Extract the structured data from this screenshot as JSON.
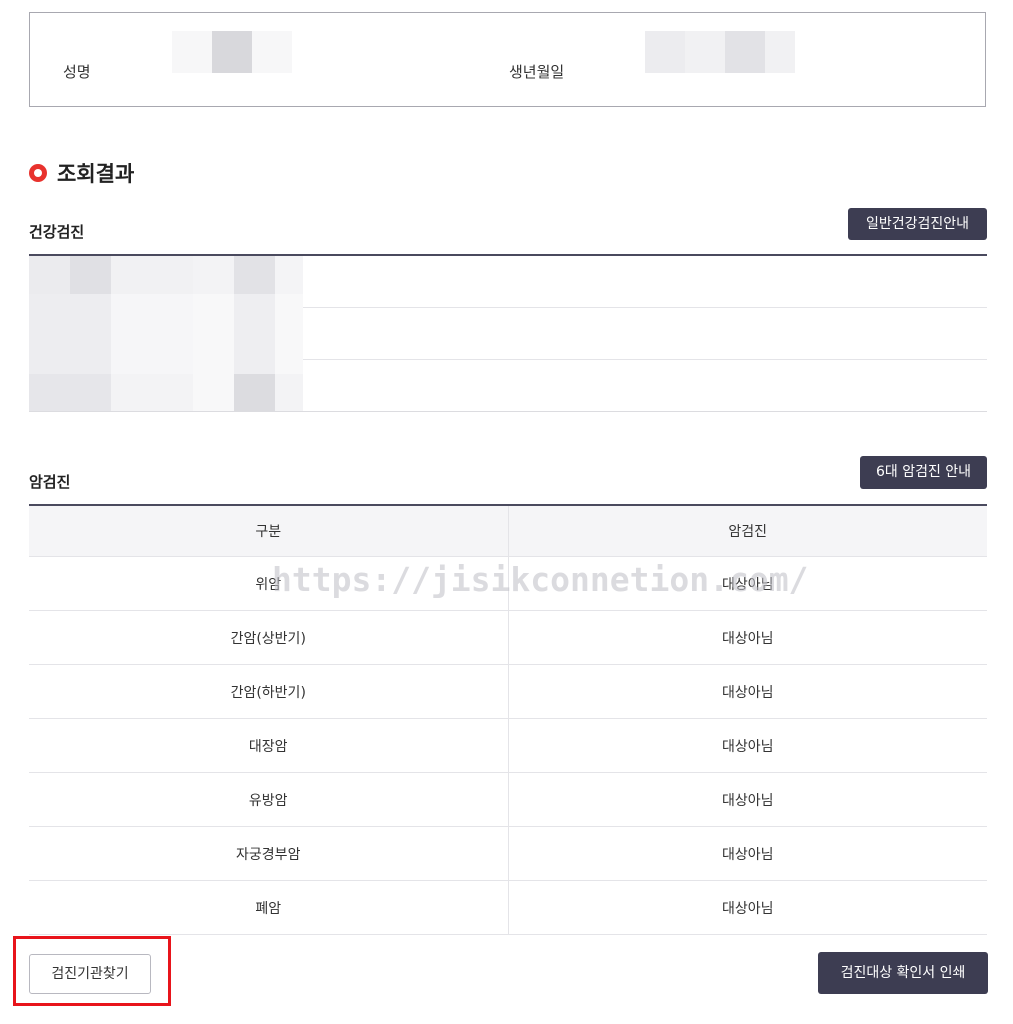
{
  "personal_info": {
    "name_label": "성명",
    "birth_label": "생년월일"
  },
  "results": {
    "title": "조회결과",
    "health_checkup": {
      "heading": "건강검진",
      "guide_button": "일반건강검진안내"
    },
    "cancer_checkup": {
      "heading": "암검진",
      "guide_button": "6대 암검진 안내",
      "columns": [
        "구분",
        "암검진"
      ],
      "rows": [
        {
          "type": "위암",
          "status": "대상아님"
        },
        {
          "type": "간암(상반기)",
          "status": "대상아님"
        },
        {
          "type": "간암(하반기)",
          "status": "대상아님"
        },
        {
          "type": "대장암",
          "status": "대상아님"
        },
        {
          "type": "유방암",
          "status": "대상아님"
        },
        {
          "type": "자궁경부암",
          "status": "대상아님"
        },
        {
          "type": "폐암",
          "status": "대상아님"
        }
      ]
    }
  },
  "watermark": "https://jisikconnetion.com/",
  "actions": {
    "find_institution": "검진기관찾기",
    "print_confirmation": "검진대상 확인서 인쇄"
  },
  "colors": {
    "accent_red": "#e8322d",
    "dark_button": "#3d3d52",
    "highlight": "#e8141b"
  }
}
